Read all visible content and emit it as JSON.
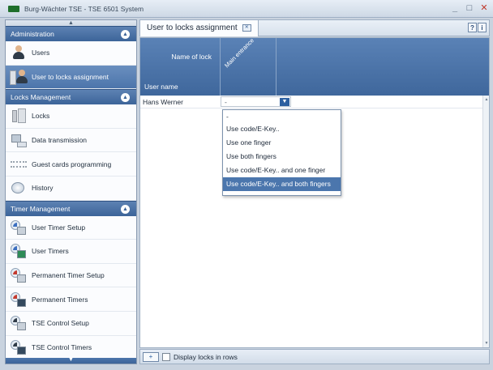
{
  "window": {
    "title": "Burg-Wächter  TSE - TSE 6501 System",
    "minimize": "_",
    "maximize": "□",
    "close": "✕"
  },
  "sidebar": {
    "sections": [
      {
        "title": "Administration",
        "items": [
          {
            "label": "Users",
            "icon": "user-icon"
          },
          {
            "label": "User to locks assignment",
            "icon": "user-lock-assignment-icon",
            "active": true
          }
        ]
      },
      {
        "title": "Locks Management",
        "items": [
          {
            "label": "Locks",
            "icon": "lock-icon"
          },
          {
            "label": "Data transmission",
            "icon": "data-transmission-icon"
          },
          {
            "label": "Guest cards programming",
            "icon": "guest-cards-icon"
          },
          {
            "label": "History",
            "icon": "history-icon"
          }
        ]
      },
      {
        "title": "Timer Management",
        "items": [
          {
            "label": "User Timer Setup",
            "icon": "user-timer-setup-icon"
          },
          {
            "label": "User Timers",
            "icon": "user-timers-icon"
          },
          {
            "label": "Permanent Timer Setup",
            "icon": "permanent-timer-setup-icon"
          },
          {
            "label": "Permanent Timers",
            "icon": "permanent-timers-icon"
          },
          {
            "label": "TSE Control Setup",
            "icon": "tse-control-setup-icon"
          },
          {
            "label": "TSE Control Timers",
            "icon": "tse-control-timers-icon"
          }
        ]
      }
    ]
  },
  "main": {
    "tab_label": "User to locks assignment",
    "help_buttons": [
      "?",
      "i"
    ],
    "grid": {
      "header_lock_name": "Name of lock",
      "header_user_name": "User name",
      "lock_columns": [
        "Main entrance"
      ],
      "rows": [
        {
          "user": "Hans Werner",
          "value": "-"
        }
      ]
    },
    "dropdown_options": [
      "-",
      "Use code/E-Key..",
      "Use one finger",
      "Use both fingers",
      "Use code/E-Key.. and one finger",
      "Use code/E-Key.. and both fingers"
    ],
    "dropdown_selected_index": 5
  },
  "footer": {
    "toggle_label": "+",
    "display_locks_label": "Display locks in rows",
    "display_locks_checked": false
  }
}
